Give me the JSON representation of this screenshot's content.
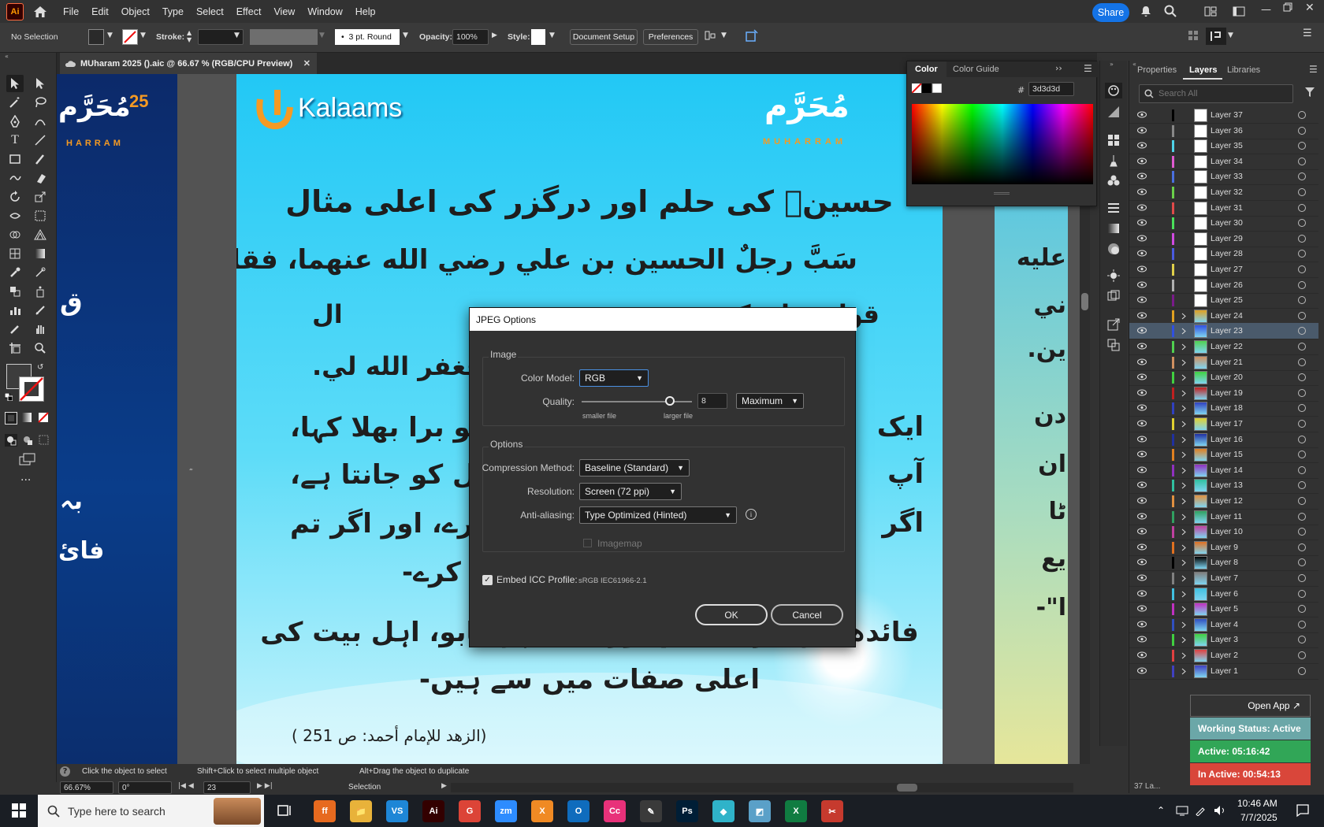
{
  "app": {
    "logo": "Ai"
  },
  "menus": [
    "File",
    "Edit",
    "Object",
    "Type",
    "Select",
    "Effect",
    "View",
    "Window",
    "Help"
  ],
  "share_label": "Share",
  "control": {
    "selection": "No Selection",
    "stroke_label": "Stroke:",
    "brush": "3 pt. Round",
    "opacity_label": "Opacity:",
    "opacity_value": "100%",
    "style_label": "Style:",
    "document_setup": "Document Setup",
    "preferences": "Preferences"
  },
  "document_tab": {
    "title": "MUharam 2025 ().aic @ 66.67 % (RGB/CPU Preview)"
  },
  "color_panel": {
    "tab_color": "Color",
    "tab_guide": "Color Guide",
    "hex_label": "#",
    "hex": "3d3d3d"
  },
  "layers_panel": {
    "tabs": [
      "Properties",
      "Layers",
      "Libraries"
    ],
    "search_placeholder": "Search All",
    "footer_count": "37 La...",
    "layers": [
      {
        "name": "Layer 37",
        "color": "#000000",
        "has_art": false
      },
      {
        "name": "Layer 36",
        "color": "#888888",
        "has_art": false
      },
      {
        "name": "Layer 35",
        "color": "#4fd3e8",
        "has_art": false
      },
      {
        "name": "Layer 34",
        "color": "#e05ad0",
        "has_art": false
      },
      {
        "name": "Layer 33",
        "color": "#4a6fe0",
        "has_art": false
      },
      {
        "name": "Layer 32",
        "color": "#6ad04a",
        "has_art": false
      },
      {
        "name": "Layer 31",
        "color": "#e04a4a",
        "has_art": false
      },
      {
        "name": "Layer 30",
        "color": "#4ae05a",
        "has_art": false
      },
      {
        "name": "Layer 29",
        "color": "#d04ae0",
        "has_art": false
      },
      {
        "name": "Layer 28",
        "color": "#4a5ae0",
        "has_art": false
      },
      {
        "name": "Layer 27",
        "color": "#e0d04a",
        "has_art": false
      },
      {
        "name": "Layer 26",
        "color": "#b0b0b0",
        "has_art": false
      },
      {
        "name": "Layer 25",
        "color": "#7a1a8a",
        "has_art": false
      },
      {
        "name": "Layer 24",
        "color": "#e0a020",
        "has_art": true
      },
      {
        "name": "Layer 23",
        "color": "#3050e0",
        "has_art": true,
        "selected": true
      },
      {
        "name": "Layer 22",
        "color": "#50d050",
        "has_art": true
      },
      {
        "name": "Layer 21",
        "color": "#d09060",
        "has_art": true
      },
      {
        "name": "Layer 20",
        "color": "#40d040",
        "has_art": true
      },
      {
        "name": "Layer 19",
        "color": "#c02020",
        "has_art": true
      },
      {
        "name": "Layer 18",
        "color": "#3040c0",
        "has_art": true
      },
      {
        "name": "Layer 17",
        "color": "#e0d030",
        "has_art": true
      },
      {
        "name": "Layer 16",
        "color": "#2030a0",
        "has_art": true
      },
      {
        "name": "Layer 15",
        "color": "#e08020",
        "has_art": true
      },
      {
        "name": "Layer 14",
        "color": "#9030c0",
        "has_art": true
      },
      {
        "name": "Layer 13",
        "color": "#30c0a0",
        "has_art": true
      },
      {
        "name": "Layer 12",
        "color": "#e09040",
        "has_art": true
      },
      {
        "name": "Layer 11",
        "color": "#30a060",
        "has_art": true
      },
      {
        "name": "Layer 10",
        "color": "#c040a0",
        "has_art": true
      },
      {
        "name": "Layer 9",
        "color": "#e07020",
        "has_art": true
      },
      {
        "name": "Layer 8",
        "color": "#000000",
        "has_art": true
      },
      {
        "name": "Layer 7",
        "color": "#808080",
        "has_art": true
      },
      {
        "name": "Layer 6",
        "color": "#40c0e0",
        "has_art": true
      },
      {
        "name": "Layer 5",
        "color": "#c030c0",
        "has_art": true
      },
      {
        "name": "Layer 4",
        "color": "#3050c0",
        "has_art": true
      },
      {
        "name": "Layer 3",
        "color": "#40d040",
        "has_art": true
      },
      {
        "name": "Layer 2",
        "color": "#e04040",
        "has_art": true
      },
      {
        "name": "Layer 1",
        "color": "#4040c0",
        "has_art": true
      }
    ]
  },
  "widgets": {
    "open_app": "Open App",
    "working_status": "Working Status: Active",
    "active": "Active: 05:16:42",
    "inactive": "In Active: 00:54:13"
  },
  "artwork": {
    "brand": "Kalaams",
    "heading": "حسینؓ کی حلم اور درگزر کی اعلی مثال",
    "arabic_line1": "سَبَّ رجلٌ الحسين بن علي رضي الله عنهما، فقال له",
    "arabic_line2": "ال",
    "arabic_line2b": "قول، فإن كنتَ",
    "arabic_line3": "فغفر الله لي.",
    "urdu_line1a": "ایک",
    "urdu_line1b": "کو برا بھلا کہا،",
    "urdu_line2a": "آپ",
    "urdu_line2b": "دل کو جانتا ہے،",
    "urdu_line3a": "اگر",
    "urdu_line3b": "کرے، اور اگر تم",
    "urdu_line4": "کرے-",
    "urdu_line5": "فائدہ: بردباری، علم اور غصے پر قابو، اہل بیت کی",
    "urdu_line6": "اعلی صفات میں سے ہیں-",
    "reference": "(الزهد للإمام أحمد: ص 251 )",
    "left_num": "25",
    "left_title": "مُحَرَّم",
    "left_sub": "HARRAM",
    "left_frag1": "ق",
    "left_frag2": "بہ",
    "left_frag3": "فائ",
    "right_title": "مُحَرَّم",
    "right_sub": "MUHARRAM",
    "right_frag1": "عليه",
    "right_frag2": "ني",
    "right_frag3": "ين.",
    "right_frag4": "دن",
    "right_frag5": "ان",
    "right_frag6": "ٹا",
    "right_frag7": "یع",
    "right_frag8": "ا\"-"
  },
  "dialog": {
    "title": "JPEG Options",
    "image_group": "Image",
    "color_model_label": "Color Model:",
    "color_model": "RGB",
    "quality_label": "Quality:",
    "quality_value": "8",
    "quality_preset": "Maximum",
    "quality_level": 0.8,
    "smaller_file": "smaller file",
    "larger_file": "larger file",
    "options_group": "Options",
    "compression_label": "Compression Method:",
    "compression": "Baseline (Standard)",
    "resolution_label": "Resolution:",
    "resolution": "Screen (72 ppi)",
    "antialias_label": "Anti-aliasing:",
    "antialias": "Type Optimized (Hinted)",
    "imagemap": "Imagemap",
    "embed_icc": "Embed ICC Profile:",
    "icc_profile": "sRGB IEC61966-2.1",
    "ok": "OK",
    "cancel": "Cancel"
  },
  "status": {
    "hint_a": "Click the object to select",
    "hint_b": "Shift+Click to select multiple object",
    "hint_c": "Alt+Drag the object to duplicate",
    "zoom": "66.67%",
    "rotation": "0°",
    "artboard": "23",
    "tool": "Selection"
  },
  "taskbar": {
    "search_placeholder": "Type here to search",
    "time": "10:46 AM",
    "date": "7/7/2025",
    "apps": [
      {
        "label": "ff",
        "color": "#e76a1f"
      },
      {
        "label": "📁",
        "color": "#e8b23a"
      },
      {
        "label": "VS",
        "color": "#1e86d6"
      },
      {
        "label": "Ai",
        "color": "#330000"
      },
      {
        "label": "G",
        "color": "#dc4437"
      },
      {
        "label": "zm",
        "color": "#2d8cff"
      },
      {
        "label": "X",
        "color": "#f08a24"
      },
      {
        "label": "O",
        "color": "#0f6cbd"
      },
      {
        "label": "Cc",
        "color": "#e8317a"
      },
      {
        "label": "✎",
        "color": "#3a3a3a"
      },
      {
        "label": "Ps",
        "color": "#001e36"
      },
      {
        "label": "◆",
        "color": "#2fb3c9"
      },
      {
        "label": "◩",
        "color": "#5aa0c8"
      },
      {
        "label": "X",
        "color": "#107c41"
      },
      {
        "label": "✂",
        "color": "#c63a2e"
      }
    ]
  }
}
